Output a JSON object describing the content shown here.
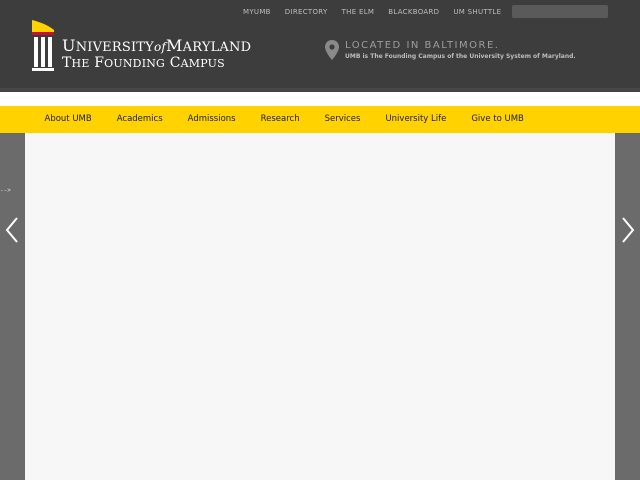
{
  "utility_nav": [
    "MYUMB",
    "DIRECTORY",
    "THE ELM",
    "BLACKBOARD",
    "UM SHUTTLE"
  ],
  "search": {
    "placeholder": ""
  },
  "logo": {
    "line1_a": "U",
    "line1_b": "NIVERSITY",
    "line1_of": "of",
    "line1_c": "M",
    "line1_d": "ARYLAND",
    "line2_a": "T",
    "line2_b": "HE",
    "line2_c": "F",
    "line2_d": "OUNDING",
    "line2_e": "C",
    "line2_f": "AMPUS"
  },
  "located": {
    "title": "LOCATED IN BALTIMORE.",
    "subtitle": "UMB is The Founding Campus of the University System of Maryland."
  },
  "main_nav": [
    "About UMB",
    "Academics",
    "Admissions",
    "Research",
    "Services",
    "University Life",
    "Give to UMB"
  ],
  "slider": {
    "stray_text": "-->",
    "prev_label": "previous slide",
    "next_label": "next slide"
  },
  "colors": {
    "header_bg": "#3d3d3d",
    "nav_gold": "#ffd200",
    "brand_red": "#c8102e"
  }
}
